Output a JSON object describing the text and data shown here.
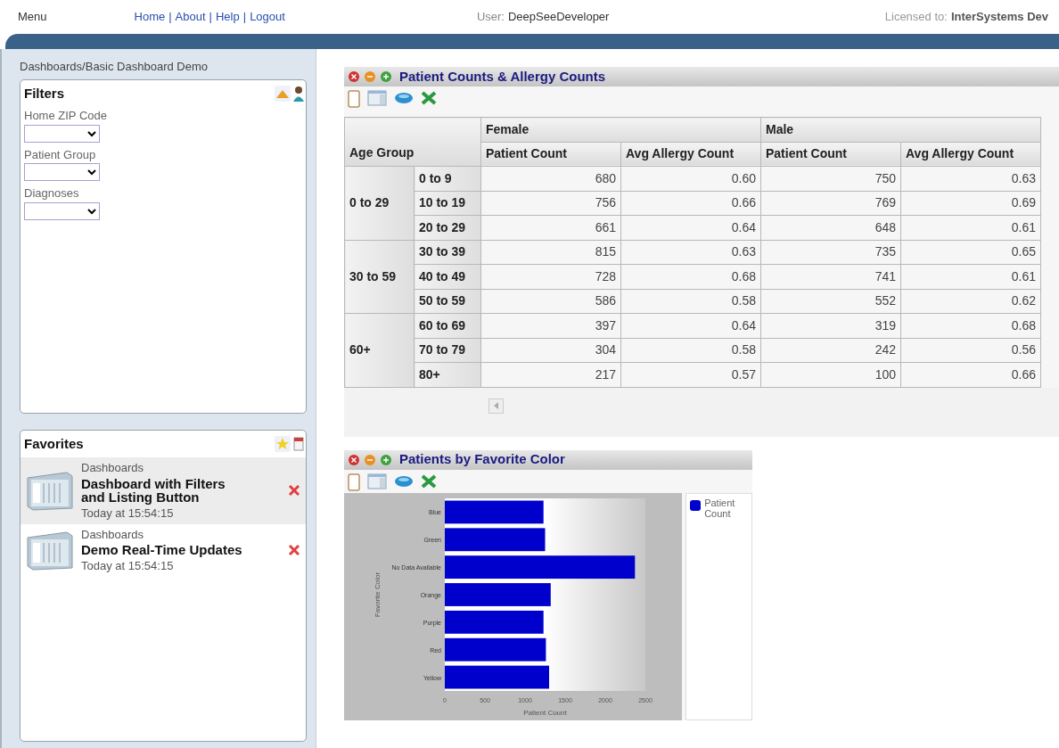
{
  "topbar": {
    "menu": "Menu",
    "links": [
      "Home",
      "About",
      "Help",
      "Logout"
    ],
    "separator": "|",
    "user_label": "User:",
    "user_name": "DeepSeeDeveloper",
    "license_label": "Licensed to:",
    "license_name": "InterSystems Dev"
  },
  "sidebar": {
    "breadcrumb": "Dashboards/Basic Dashboard Demo",
    "filters": {
      "title": "Filters",
      "items": [
        {
          "label": "Home ZIP Code"
        },
        {
          "label": "Patient Group"
        },
        {
          "label": "Diagnoses"
        }
      ]
    },
    "favorites": {
      "title": "Favorites",
      "items": [
        {
          "category": "Dashboards",
          "title": "Dashboard with Filters and Listing Button",
          "time": "Today at 15:54:15",
          "selected": true
        },
        {
          "category": "Dashboards",
          "title": "Demo Real-Time Updates",
          "time": "Today at 15:54:15",
          "selected": false
        }
      ]
    }
  },
  "pivot": {
    "title": "Patient Counts & Allergy Counts",
    "row_header": "Age Group",
    "column_groups": [
      "Female",
      "Male"
    ],
    "measures": [
      "Patient Count",
      "Avg Allergy Count",
      "Patient Count",
      "Avg Allergy Count"
    ],
    "row_groups": [
      {
        "label": "0 to 29",
        "rows": [
          {
            "label": "0 to 9",
            "values": [
              "680",
              "0.60",
              "750",
              "0.63"
            ]
          },
          {
            "label": "10 to 19",
            "values": [
              "756",
              "0.66",
              "769",
              "0.69"
            ]
          },
          {
            "label": "20 to 29",
            "values": [
              "661",
              "0.64",
              "648",
              "0.61"
            ]
          }
        ]
      },
      {
        "label": "30 to 59",
        "rows": [
          {
            "label": "30 to 39",
            "values": [
              "815",
              "0.63",
              "735",
              "0.65"
            ]
          },
          {
            "label": "40 to 49",
            "values": [
              "728",
              "0.68",
              "741",
              "0.61"
            ]
          },
          {
            "label": "50 to 59",
            "values": [
              "586",
              "0.58",
              "552",
              "0.62"
            ]
          }
        ]
      },
      {
        "label": "60+",
        "rows": [
          {
            "label": "60 to 69",
            "values": [
              "397",
              "0.64",
              "319",
              "0.68"
            ]
          },
          {
            "label": "70 to 79",
            "values": [
              "304",
              "0.58",
              "242",
              "0.56"
            ]
          },
          {
            "label": "80+",
            "values": [
              "217",
              "0.57",
              "100",
              "0.66"
            ]
          }
        ]
      }
    ]
  },
  "chart_panel": {
    "title": "Patients by Favorite Color",
    "chart_data": {
      "type": "bar",
      "orientation": "horizontal",
      "ylabel": "Favorite Color",
      "xlabel": "Patient Count",
      "categories": [
        "Blue",
        "Green",
        "No Data Available",
        "Orange",
        "Purple",
        "Red",
        "Yellow"
      ],
      "series": [
        {
          "name": "Patient Count",
          "color": "#0000cc",
          "values": [
            1230,
            1250,
            2370,
            1320,
            1230,
            1260,
            1300
          ]
        }
      ],
      "xlim": [
        0,
        2500
      ],
      "xticks": [
        0,
        500,
        1000,
        1500,
        2000,
        2500
      ]
    }
  }
}
